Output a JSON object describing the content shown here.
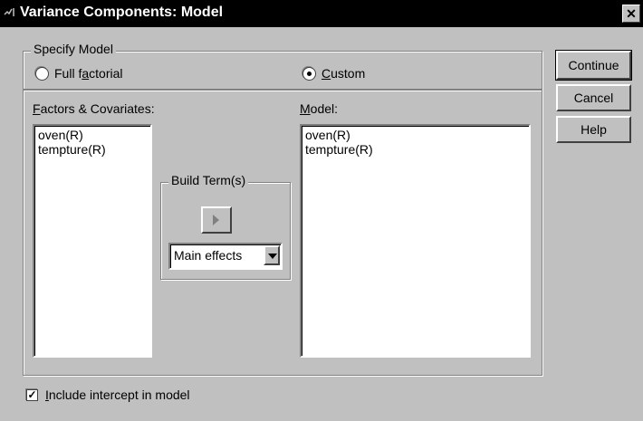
{
  "window": {
    "title": "Variance Components: Model",
    "close_glyph": "✕"
  },
  "specify_model": {
    "legend": "Specify Model",
    "full_factorial_pre": "Full f",
    "full_factorial_u": "a",
    "full_factorial_post": "ctorial",
    "custom_u": "C",
    "custom_post": "ustom",
    "selected": "custom"
  },
  "factors": {
    "label_u": "F",
    "label_post": "actors & Covariates:",
    "items": [
      "oven(R)",
      "tempture(R)"
    ]
  },
  "build_terms": {
    "legend": "Build Term(s)",
    "combo_value": "Main effects"
  },
  "model": {
    "label_u": "M",
    "label_post": "odel:",
    "items": [
      "oven(R)",
      "tempture(R)"
    ]
  },
  "buttons": {
    "continue": "Continue",
    "cancel": "Cancel",
    "help": "Help"
  },
  "intercept": {
    "checked": true,
    "check_glyph": "✓",
    "label_u": "I",
    "label_post": "nclude intercept in model"
  }
}
